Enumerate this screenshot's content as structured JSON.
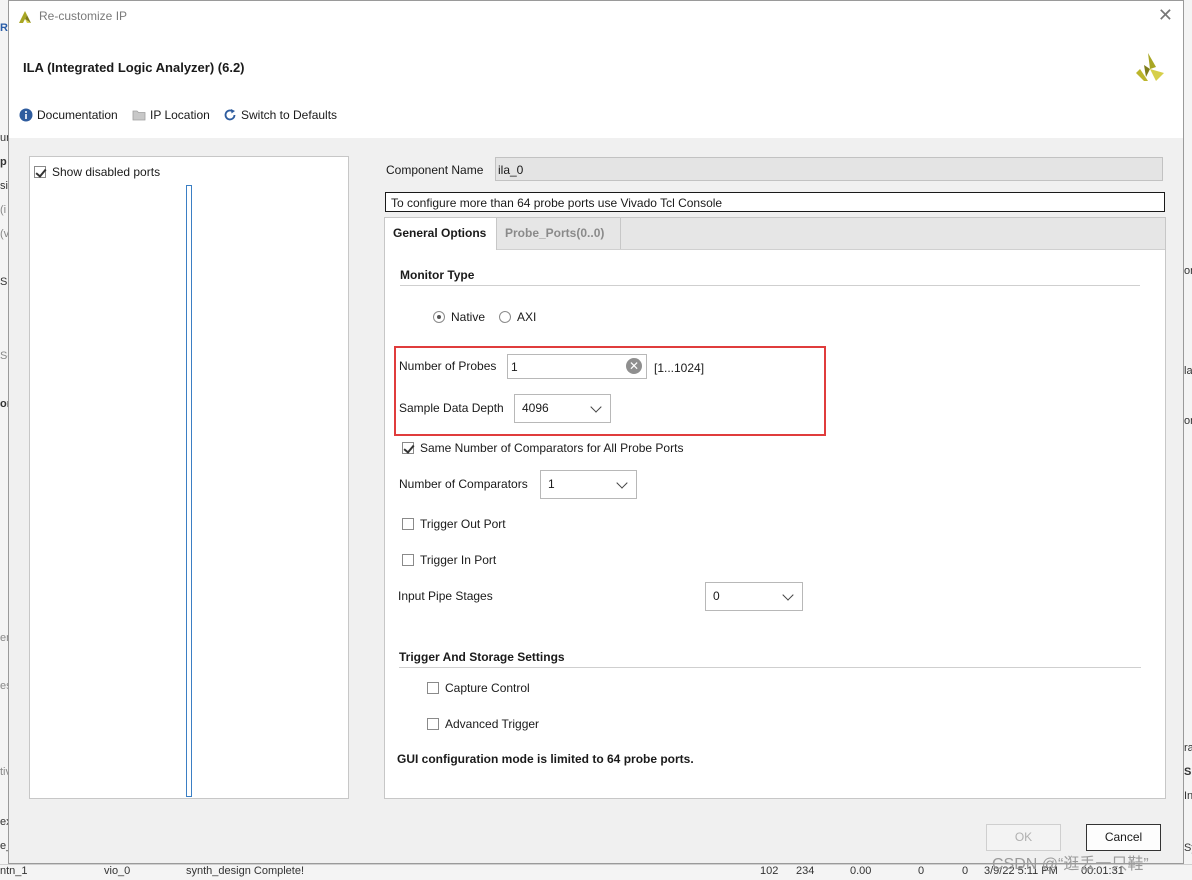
{
  "background": {
    "left_fragments": [
      "R",
      "ur",
      "p",
      "si",
      "(i",
      "(v",
      "S",
      "So",
      "ort",
      "en",
      "es",
      "tiv",
      "ex",
      "e_",
      "ntn_1"
    ],
    "right_fragments": [
      "on",
      "la",
      "on",
      "ra",
      "S",
      "In",
      "Sy",
      "Vivado S"
    ],
    "bottom_row": [
      "vio_0",
      "synth_design Complete!",
      "102",
      "234",
      "0.00",
      "0",
      "0",
      "3/9/22 5:11 PM",
      "00:01:31"
    ]
  },
  "dialog": {
    "title": "Re-customize IP",
    "close_icon": "close-icon",
    "ip_title": "ILA (Integrated Logic Analyzer) (6.2)"
  },
  "toolbar": {
    "documentation": "Documentation",
    "ip_location": "IP Location",
    "switch_defaults": "Switch to Defaults"
  },
  "left_panel": {
    "show_disabled_ports": "Show disabled ports",
    "show_disabled_checked": true
  },
  "component": {
    "label": "Component Name",
    "value": "ila_0"
  },
  "info_text": "To configure more than 64 probe ports use Vivado Tcl Console",
  "tabs": [
    {
      "label": "General Options",
      "active": true
    },
    {
      "label": "Probe_Ports(0..0)",
      "active": false
    }
  ],
  "general": {
    "monitor_type_title": "Monitor Type",
    "native_label": "Native",
    "axi_label": "AXI",
    "selected_monitor": "Native",
    "num_probes_label": "Number of Probes",
    "num_probes_value": "1",
    "num_probes_range": "[1...1024]",
    "sample_depth_label": "Sample Data Depth",
    "sample_depth_value": "4096",
    "same_comparators_label": "Same Number of Comparators for All Probe Ports",
    "same_comparators_checked": true,
    "num_comparators_label": "Number of Comparators",
    "num_comparators_value": "1",
    "trigger_out_label": "Trigger Out Port",
    "trigger_in_label": "Trigger In Port",
    "pipe_stages_label": "Input Pipe Stages",
    "pipe_stages_value": "0",
    "trigger_storage_title": "Trigger And Storage Settings",
    "capture_control_label": "Capture Control",
    "advanced_trigger_label": "Advanced Trigger",
    "limit_note": "GUI configuration mode is limited to 64 probe ports."
  },
  "buttons": {
    "ok": "OK",
    "cancel": "Cancel"
  },
  "watermark": "CSDN @“逛丢一只鞋”",
  "colors": {
    "highlight_red": "#e03c3c",
    "brand_olive": "#a8a623",
    "info_blue": "#2e5c9e"
  }
}
